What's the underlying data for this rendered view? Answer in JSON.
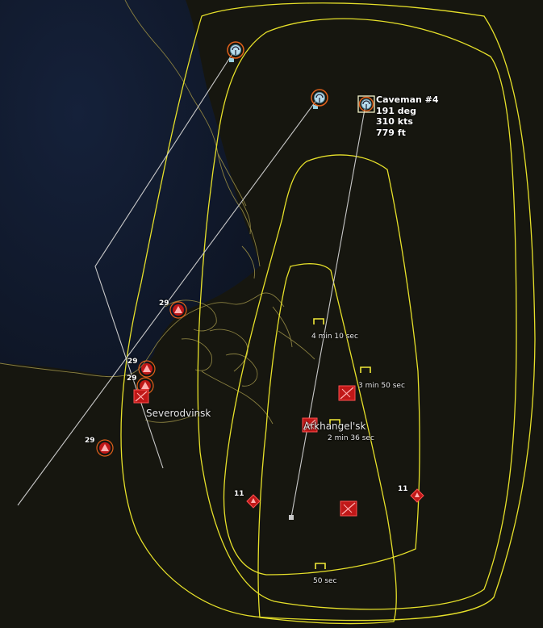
{
  "selected_unit": {
    "name": "Caveman #4",
    "heading": "191 deg",
    "speed": "310 kts",
    "altitude": "779 ft"
  },
  "places": {
    "severodvinsk": "Severodvinsk",
    "arkhangelsk": "Arkhangel'sk"
  },
  "waypoint_timers": [
    "4 min 10 sec",
    "3 min 50 sec",
    "2 min 36 sec",
    "50 sec"
  ],
  "unit_counts": {
    "site_a": "29",
    "site_b": "29",
    "site_c": "29",
    "site_d": "29",
    "site_e": "11",
    "site_f": "11"
  },
  "colors": {
    "range_ring": "#e6e02a",
    "coastline": "#8a8040",
    "hostile": "#d11a1a",
    "track_line": "#c8c8c8",
    "sea": "#111a2c",
    "land": "#16160f"
  },
  "icons": {
    "aircraft": "aircraft-unit-icon",
    "sam_site": "sam-site-icon",
    "airbase": "airbase-icon",
    "waypoint": "waypoint-bracket-icon"
  }
}
